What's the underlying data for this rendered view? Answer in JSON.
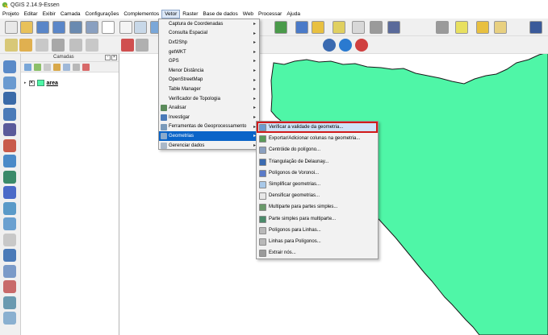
{
  "window": {
    "title": "QGIS 2.14.9-Essen"
  },
  "menubar": {
    "items": [
      "Projeto",
      "Editar",
      "Exibir",
      "Camada",
      "Configurações",
      "Complementos",
      "Vetor",
      "Raster",
      "Base de dados",
      "Web",
      "Processar",
      "Ajuda"
    ],
    "active_index": 6
  },
  "layers_panel": {
    "title": "Camadas",
    "layers": [
      {
        "name": "area",
        "checked": true,
        "color": "#4ff6a7"
      }
    ]
  },
  "vector_menu": {
    "items": [
      {
        "label": "Captura de Coordenadas",
        "icon": "none",
        "submenu": true
      },
      {
        "label": "Consulta Espacial",
        "icon": "none",
        "submenu": true
      },
      {
        "label": "Dxf2Shp",
        "icon": "none",
        "submenu": true
      },
      {
        "label": "getWKT",
        "icon": "none",
        "submenu": true
      },
      {
        "label": "GPS",
        "icon": "none",
        "submenu": true
      },
      {
        "label": "Menor Distância",
        "icon": "none",
        "submenu": true
      },
      {
        "label": "OpenStreetMap",
        "icon": "none",
        "submenu": true
      },
      {
        "label": "Table Manager",
        "icon": "none",
        "submenu": true
      },
      {
        "label": "Verificador de Topologia",
        "icon": "none",
        "submenu": true
      },
      {
        "label": "Analisar",
        "icon": "analyze-icon",
        "submenu": true
      },
      {
        "label": "Investigar",
        "icon": "research-icon",
        "submenu": true
      },
      {
        "label": "Ferramentas de Geoprocessamento",
        "icon": "geoprocessing-icon",
        "submenu": true
      },
      {
        "label": "Geometrias",
        "icon": "geometry-icon",
        "submenu": true,
        "highlighted": true
      },
      {
        "label": "Gerenciar dados",
        "icon": "data-management-icon",
        "submenu": true
      }
    ]
  },
  "geometry_submenu": {
    "items": [
      {
        "label": "Verificar a validade da geometria...",
        "icon": "check-geometry-icon",
        "highlighted": true
      },
      {
        "label": "Exportar/Adicionar colunas na geometria...",
        "icon": "export-geometry-icon"
      },
      {
        "label": "Centróide do polígono...",
        "icon": "centroid-icon"
      },
      {
        "label": "Triangulação de Delaunay...",
        "icon": "delaunay-icon"
      },
      {
        "label": "Polígonos de Voronoi...",
        "icon": "voronoi-icon"
      },
      {
        "label": "Simplificar geometrias...",
        "icon": "simplify-icon"
      },
      {
        "label": "Densificar geometrias...",
        "icon": "densify-icon"
      },
      {
        "label": "Multiparte para partes simples...",
        "icon": "multi-to-single-icon"
      },
      {
        "label": "Parte simples para multiparte...",
        "icon": "single-to-multi-icon"
      },
      {
        "label": "Polígonos para Linhas...",
        "icon": "polygon-to-line-icon"
      },
      {
        "label": "Linhas para Polígonos...",
        "icon": "line-to-polygon-icon"
      },
      {
        "label": "Extrair nós...",
        "icon": "extract-nodes-icon"
      }
    ]
  },
  "colors": {
    "polygon_fill": "#4ff6a7",
    "polygon_stroke": "#1a1a1a",
    "menu_highlight": "#0a64c8",
    "submenu_highlight_border": "#d11a1a"
  }
}
